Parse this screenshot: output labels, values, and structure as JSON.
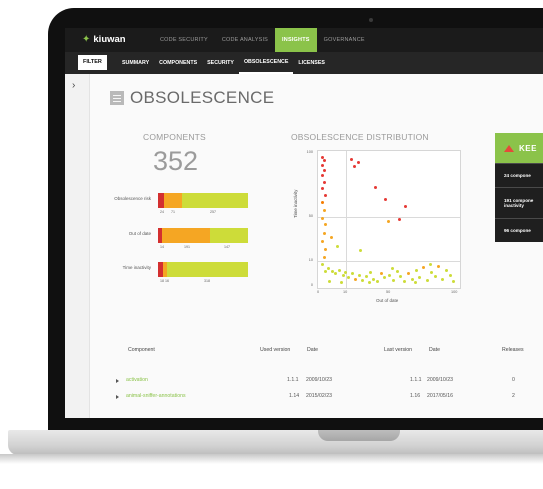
{
  "app": {
    "logo": "kiuwan"
  },
  "nav": [
    "CODE SECURITY",
    "CODE ANALYSIS",
    "INSIGHTS",
    "GOVERNANCE"
  ],
  "nav_active": "INSIGHTS",
  "subnav": {
    "filter": "FILTER",
    "items": [
      "SUMMARY",
      "COMPONENTS",
      "SECURITY",
      "OBSOLESCENCE",
      "LICENSES"
    ],
    "active": "OBSOLESCENCE"
  },
  "page": {
    "title": "OBSOLESCENCE"
  },
  "components": {
    "title": "COMPONENTS",
    "count": "352",
    "rows": [
      {
        "label": "Obsolescence risk",
        "segments": [
          {
            "value": 24,
            "color": "#d32f2f"
          },
          {
            "value": 71,
            "color": "#f5a623"
          },
          {
            "value": 257,
            "color": "#cddc39"
          }
        ],
        "nums": [
          "24",
          "71",
          "257"
        ]
      },
      {
        "label": "Out of date",
        "segments": [
          {
            "value": 14,
            "color": "#d32f2f"
          },
          {
            "value": 191,
            "color": "#f5a623"
          },
          {
            "value": 147,
            "color": "#cddc39"
          }
        ],
        "nums": [
          "14",
          "191",
          "147"
        ]
      },
      {
        "label": "Time inactivity",
        "segments": [
          {
            "value": 18,
            "color": "#d32f2f"
          },
          {
            "value": 16,
            "color": "#f5a623"
          },
          {
            "value": 318,
            "color": "#cddc39"
          }
        ],
        "nums": [
          "18 16",
          "318"
        ]
      }
    ]
  },
  "distribution": {
    "title": "OBSOLESCENCE DISTRIBUTION",
    "ylabel": "Time inactivity",
    "xlabel": "Out of date",
    "yticks": [
      "100",
      "50",
      "10",
      "0"
    ],
    "xticks": [
      "0",
      "10",
      "50",
      "100"
    ]
  },
  "chart_data": {
    "type": "scatter",
    "title": "OBSOLESCENCE DISTRIBUTION",
    "xlabel": "Out of date",
    "ylabel": "Time inactivity",
    "xlim": [
      0,
      100
    ],
    "ylim": [
      0,
      100
    ],
    "points": [
      {
        "x": 1,
        "y": 99,
        "c": "#e53935"
      },
      {
        "x": 2,
        "y": 97,
        "c": "#e53935"
      },
      {
        "x": 1,
        "y": 93,
        "c": "#e53935"
      },
      {
        "x": 2,
        "y": 89,
        "c": "#e53935"
      },
      {
        "x": 1,
        "y": 85,
        "c": "#e53935"
      },
      {
        "x": 2,
        "y": 80,
        "c": "#e53935"
      },
      {
        "x": 1,
        "y": 75,
        "c": "#e53935"
      },
      {
        "x": 3,
        "y": 70,
        "c": "#e53935"
      },
      {
        "x": 1,
        "y": 64,
        "c": "#f57c00"
      },
      {
        "x": 2,
        "y": 58,
        "c": "#f5a623"
      },
      {
        "x": 1,
        "y": 52,
        "c": "#f5a623"
      },
      {
        "x": 3,
        "y": 47,
        "c": "#f5a623"
      },
      {
        "x": 2,
        "y": 40,
        "c": "#f5a623"
      },
      {
        "x": 1,
        "y": 34,
        "c": "#f5a623"
      },
      {
        "x": 3,
        "y": 28,
        "c": "#f5a623"
      },
      {
        "x": 2,
        "y": 22,
        "c": "#f5a623"
      },
      {
        "x": 1,
        "y": 16,
        "c": "#cddc39"
      },
      {
        "x": 3,
        "y": 11,
        "c": "#cddc39"
      },
      {
        "x": 22,
        "y": 98,
        "c": "#e53935"
      },
      {
        "x": 27,
        "y": 95,
        "c": "#e53935"
      },
      {
        "x": 24,
        "y": 92,
        "c": "#e53935"
      },
      {
        "x": 40,
        "y": 76,
        "c": "#e53935"
      },
      {
        "x": 47,
        "y": 67,
        "c": "#e53935"
      },
      {
        "x": 62,
        "y": 61,
        "c": "#e53935"
      },
      {
        "x": 57,
        "y": 51,
        "c": "#e53935"
      },
      {
        "x": 49,
        "y": 50,
        "c": "#f5a623"
      },
      {
        "x": 7,
        "y": 37,
        "c": "#f5a623"
      },
      {
        "x": 12,
        "y": 30,
        "c": "#cddc39"
      },
      {
        "x": 29,
        "y": 27,
        "c": "#cddc39"
      },
      {
        "x": 5,
        "y": 13,
        "c": "#cddc39"
      },
      {
        "x": 8,
        "y": 11,
        "c": "#cddc39"
      },
      {
        "x": 10,
        "y": 9,
        "c": "#cddc39"
      },
      {
        "x": 13,
        "y": 12,
        "c": "#cddc39"
      },
      {
        "x": 16,
        "y": 8,
        "c": "#cddc39"
      },
      {
        "x": 18,
        "y": 10,
        "c": "#cddc39"
      },
      {
        "x": 20,
        "y": 6,
        "c": "#cddc39"
      },
      {
        "x": 23,
        "y": 9,
        "c": "#cddc39"
      },
      {
        "x": 25,
        "y": 5,
        "c": "#f5a623"
      },
      {
        "x": 28,
        "y": 8,
        "c": "#cddc39"
      },
      {
        "x": 30,
        "y": 4,
        "c": "#cddc39"
      },
      {
        "x": 33,
        "y": 7,
        "c": "#cddc39"
      },
      {
        "x": 36,
        "y": 10,
        "c": "#cddc39"
      },
      {
        "x": 38,
        "y": 5,
        "c": "#cddc39"
      },
      {
        "x": 41,
        "y": 3,
        "c": "#cddc39"
      },
      {
        "x": 44,
        "y": 9,
        "c": "#f5a623"
      },
      {
        "x": 46,
        "y": 6,
        "c": "#cddc39"
      },
      {
        "x": 50,
        "y": 8,
        "c": "#cddc39"
      },
      {
        "x": 53,
        "y": 4,
        "c": "#cddc39"
      },
      {
        "x": 56,
        "y": 11,
        "c": "#cddc39"
      },
      {
        "x": 58,
        "y": 7,
        "c": "#cddc39"
      },
      {
        "x": 61,
        "y": 3,
        "c": "#cddc39"
      },
      {
        "x": 64,
        "y": 9,
        "c": "#f5a623"
      },
      {
        "x": 67,
        "y": 5,
        "c": "#cddc39"
      },
      {
        "x": 70,
        "y": 12,
        "c": "#cddc39"
      },
      {
        "x": 72,
        "y": 6,
        "c": "#cddc39"
      },
      {
        "x": 75,
        "y": 14,
        "c": "#f5a623"
      },
      {
        "x": 78,
        "y": 4,
        "c": "#cddc39"
      },
      {
        "x": 81,
        "y": 10,
        "c": "#cddc39"
      },
      {
        "x": 84,
        "y": 7,
        "c": "#cddc39"
      },
      {
        "x": 86,
        "y": 15,
        "c": "#f5a623"
      },
      {
        "x": 89,
        "y": 5,
        "c": "#cddc39"
      },
      {
        "x": 92,
        "y": 12,
        "c": "#cddc39"
      },
      {
        "x": 95,
        "y": 8,
        "c": "#cddc39"
      },
      {
        "x": 97,
        "y": 3,
        "c": "#cddc39"
      },
      {
        "x": 6,
        "y": 3,
        "c": "#cddc39"
      },
      {
        "x": 15,
        "y": 2,
        "c": "#cddc39"
      },
      {
        "x": 35,
        "y": 2,
        "c": "#cddc39"
      },
      {
        "x": 52,
        "y": 13,
        "c": "#cddc39"
      },
      {
        "x": 69,
        "y": 2,
        "c": "#cddc39"
      },
      {
        "x": 80,
        "y": 16,
        "c": "#cddc39"
      }
    ]
  },
  "keep": {
    "title": "KEE",
    "rows": [
      [
        "24 compone"
      ],
      [
        "191 compone",
        "inactivity"
      ],
      [
        "96 compone"
      ]
    ]
  },
  "table": {
    "headers": {
      "component": "Component",
      "used_version": "Used version",
      "date1": "Date",
      "last_version": "Last version",
      "date2": "Date",
      "releases": "Releases"
    },
    "rows": [
      {
        "component": "activation",
        "used_version": "1.1.1",
        "date1": "2009/10/23",
        "last_version": "1.1.1",
        "date2": "2009/10/23",
        "releases": "0"
      },
      {
        "component": "animal-sniffer-annotations",
        "used_version": "1.14",
        "date1": "2015/02/23",
        "last_version": "1.16",
        "date2": "2017/05/16",
        "releases": "2"
      }
    ]
  }
}
